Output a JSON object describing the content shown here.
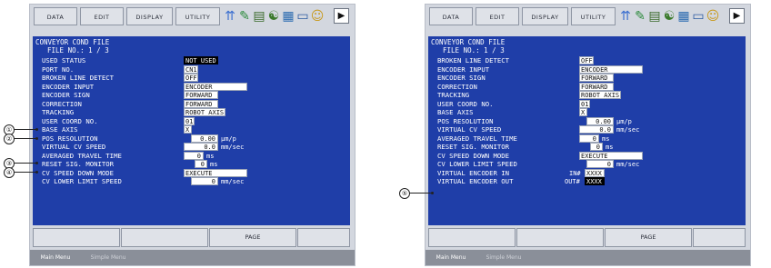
{
  "colors": {
    "panel_bg": "#d3d7df",
    "screen_bg": "#1f3ea8",
    "text": "#ffffff",
    "field_bg": "#ffffff",
    "highlight_bg": "#000000"
  },
  "menu": [
    "DATA",
    "EDIT",
    "DISPLAY",
    "UTILITY"
  ],
  "toolbar_icons": [
    "robot-arm-icon",
    "edit-document-icon",
    "chart-icon",
    "network-icon",
    "display-icon",
    "monitor-icon",
    "person-icon"
  ],
  "left": {
    "title": "CONVEYOR COND FILE",
    "file_no": "FILE NO.: 1 / 3",
    "rows": [
      {
        "label": "USED STATUS",
        "value": "NOT USED"
      },
      {
        "label": "PORT NO.",
        "value": "CN1"
      },
      {
        "label": "BROKEN LINE DETECT",
        "value": "OFF"
      },
      {
        "label": "ENCODER INPUT",
        "value": "ENCODER"
      },
      {
        "label": "ENCODER SIGN",
        "value": "FORWARD"
      },
      {
        "label": "CORRECTION",
        "value": "FORWARD"
      },
      {
        "label": "TRACKING",
        "value": "ROBOT AXIS"
      },
      {
        "label": "USER COORD NO.",
        "value": "01"
      },
      {
        "label": "BASE AXIS",
        "value": "X"
      },
      {
        "label": "POS RESOLUTION",
        "value": "0.00",
        "unit": "µm/p"
      },
      {
        "label": "VIRTUAL CV SPEED",
        "value": "0.0",
        "unit": "mm/sec"
      },
      {
        "label": "AVERAGED TRAVEL TIME",
        "value": "0",
        "unit": "ms"
      },
      {
        "label": "RESET SIG. MONITOR",
        "value": "0",
        "unit": "ms"
      },
      {
        "label": "CV SPEED DOWN MODE",
        "value": "EXECUTE"
      },
      {
        "label": "CV LOWER LIMIT SPEED",
        "value": "0",
        "unit": "mm/sec"
      }
    ]
  },
  "right": {
    "title": "CONVEYOR COND FILE",
    "file_no": "FILE NO.: 1 / 3",
    "rows": [
      {
        "label": "BROKEN LINE DETECT",
        "value": "OFF"
      },
      {
        "label": "ENCODER INPUT",
        "value": "ENCODER"
      },
      {
        "label": "ENCODER SIGN",
        "value": "FORWARD"
      },
      {
        "label": "CORRECTION",
        "value": "FORWARD"
      },
      {
        "label": "TRACKING",
        "value": "ROBOT AXIS"
      },
      {
        "label": "USER COORD NO.",
        "value": "01"
      },
      {
        "label": "BASE AXIS",
        "value": "X"
      },
      {
        "label": "POS RESOLUTION",
        "value": "0.00",
        "unit": "µm/p"
      },
      {
        "label": "VIRTUAL CV SPEED",
        "value": "0.0",
        "unit": "mm/sec"
      },
      {
        "label": "AVERAGED TRAVEL TIME",
        "value": "0",
        "unit": "ms"
      },
      {
        "label": "RESET SIG. MONITOR",
        "value": "0",
        "unit": "ms"
      },
      {
        "label": "CV SPEED DOWN MODE",
        "value": "EXECUTE"
      },
      {
        "label": "CV LOWER LIMIT SPEED",
        "value": "0",
        "unit": "mm/sec"
      },
      {
        "label": "VIRTUAL ENCODER IN",
        "prefix": "IN#",
        "value": "XXXX"
      },
      {
        "label": "VIRTUAL ENCODER OUT",
        "prefix": "OUT#",
        "value": "XXXX"
      }
    ]
  },
  "function_keys": [
    "",
    "",
    "PAGE",
    ""
  ],
  "bottom": {
    "main_menu": "Main Menu",
    "simple_menu": "Simple Menu"
  },
  "callouts": [
    "①",
    "②",
    "③",
    "④",
    "⑤"
  ]
}
